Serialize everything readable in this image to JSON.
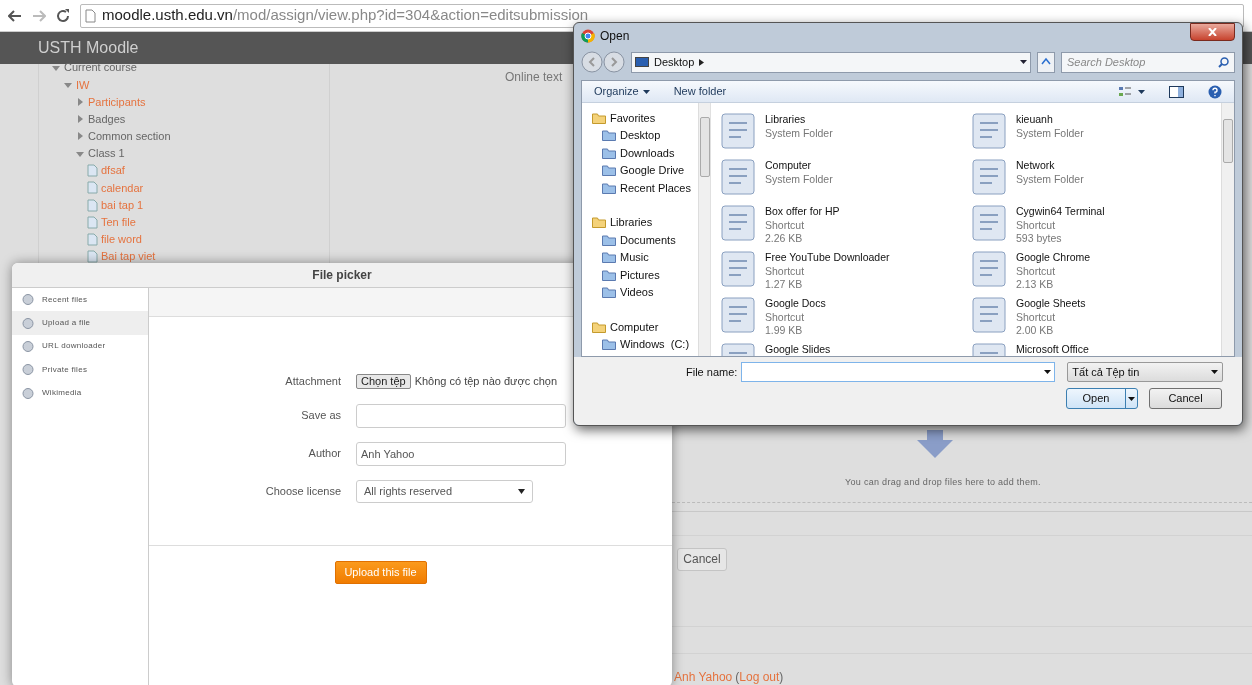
{
  "browser": {
    "url_host": "moodle.usth.edu.vn",
    "url_path": "/mod/assign/view.php?id=304&action=editsubmission"
  },
  "site_header": {
    "title": "USTH Moodle"
  },
  "nav_tree": [
    {
      "label": "Current course",
      "kind": "section",
      "expanded": true,
      "children": [
        {
          "label": "IW",
          "kind": "link",
          "expanded": true,
          "children": [
            {
              "label": "Participants",
              "kind": "link",
              "expanded": false
            },
            {
              "label": "Badges",
              "kind": "section",
              "expanded": false
            },
            {
              "label": "Common section",
              "kind": "section",
              "expanded": false
            },
            {
              "label": "Class 1",
              "kind": "section",
              "expanded": true,
              "children": [
                {
                  "label": "dfsaf",
                  "kind": "file"
                },
                {
                  "label": "calendar",
                  "kind": "file"
                },
                {
                  "label": "bai tap 1",
                  "kind": "file"
                },
                {
                  "label": "Ten file",
                  "kind": "file"
                },
                {
                  "label": "file word",
                  "kind": "file"
                },
                {
                  "label": "Bai tap viet",
                  "kind": "file"
                }
              ]
            }
          ]
        }
      ]
    }
  ],
  "page": {
    "section_heading": "Online text",
    "drop_hint": "You can drag and drop files here to add them.",
    "cancel_button": "Cancel",
    "user_name": "Anh Yahoo",
    "logout_link": "Log out",
    "paren_open": "(",
    "paren_close": ")"
  },
  "file_picker": {
    "title": "File picker",
    "sources": [
      {
        "label": "Recent files",
        "selected": false
      },
      {
        "label": "Upload a file",
        "selected": true
      },
      {
        "label": "URL downloader",
        "selected": false
      },
      {
        "label": "Private files",
        "selected": false
      },
      {
        "label": "Wikimedia",
        "selected": false
      }
    ],
    "fields": [
      {
        "kind": "file",
        "label": "Attachment",
        "button": "Chọn tệp",
        "value": "Không có tệp nào được chọn"
      },
      {
        "kind": "text",
        "label": "Save as"
      },
      {
        "kind": "text",
        "label": "Author",
        "value": "Anh Yahoo"
      },
      {
        "kind": "select",
        "label": "Choose license",
        "value": "All rights reserved"
      }
    ],
    "submit_button": "Upload this file"
  },
  "open_dialog": {
    "title": "Open",
    "location": "Desktop",
    "search_placeholder": "Search Desktop",
    "organize": "Organize",
    "new_folder": "New folder",
    "nav_groups": [
      {
        "label": "Favorites",
        "children": [
          {
            "label": "Desktop"
          },
          {
            "label": "Downloads"
          },
          {
            "label": "Google Drive"
          },
          {
            "label": "Recent Places"
          }
        ]
      },
      {
        "label": "Libraries",
        "children": [
          {
            "label": "Documents"
          },
          {
            "label": "Music"
          },
          {
            "label": "Pictures"
          },
          {
            "label": "Videos"
          }
        ]
      },
      {
        "label": "Computer",
        "children": [
          {
            "label": "Windows  (C:)"
          }
        ]
      }
    ],
    "items": [
      {
        "name": "Libraries",
        "type": "System Folder"
      },
      {
        "name": "kieuanh",
        "type": "System Folder"
      },
      {
        "name": "Computer",
        "type": "System Folder"
      },
      {
        "name": "Network",
        "type": "System Folder"
      },
      {
        "name": "Box offer for HP",
        "type": "Shortcut",
        "size": "2.26 KB"
      },
      {
        "name": "Cygwin64 Terminal",
        "type": "Shortcut",
        "size": "593 bytes"
      },
      {
        "name": "Free YouTube Downloader",
        "type": "Shortcut",
        "size": "1.27 KB"
      },
      {
        "name": "Google Chrome",
        "type": "Shortcut",
        "size": "2.13 KB"
      },
      {
        "name": "Google Docs",
        "type": "Shortcut",
        "size": "1.99 KB"
      },
      {
        "name": "Google Sheets",
        "type": "Shortcut",
        "size": "2.00 KB"
      },
      {
        "name": "Google Slides"
      },
      {
        "name": "Microsoft Office"
      }
    ],
    "file_name_label": "File name:",
    "file_type": "Tất cả Tệp tin",
    "open_button": "Open",
    "cancel_button": "Cancel"
  }
}
